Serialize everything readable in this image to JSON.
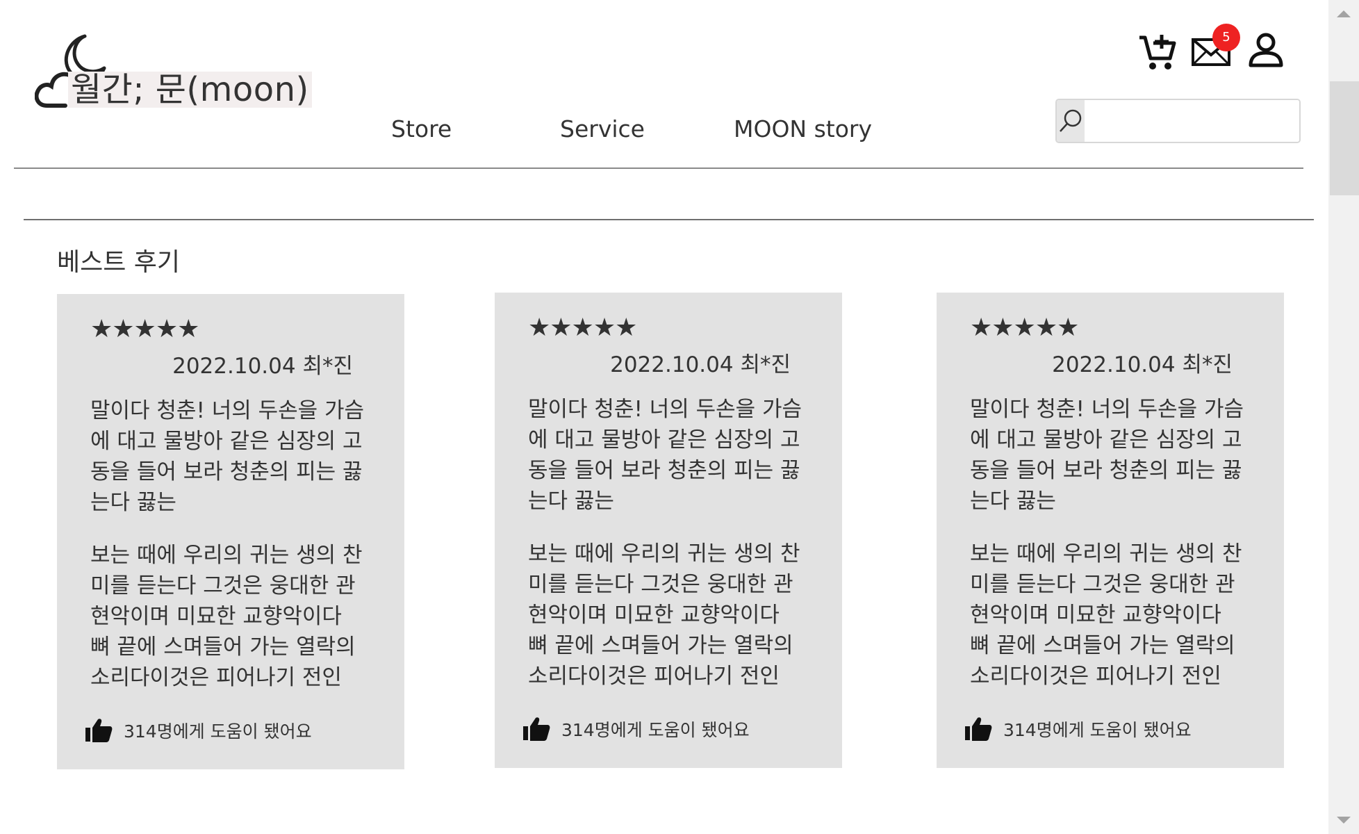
{
  "header": {
    "logo_text": "월간; 문(moon)",
    "nav": [
      "Store",
      "Service",
      "MOON story"
    ],
    "mail_badge_count": "5",
    "search": {
      "placeholder": "",
      "value": ""
    }
  },
  "section": {
    "title": "베스트 후기"
  },
  "reviews": [
    {
      "stars": "★★★★★",
      "meta": "2022.10.04 최*진",
      "p1": "말이다 청춘! 너의 두손을 가슴에 대고 물방아 같은 심장의 고동을 들어 보라 청춘의 피는 끓는다 끓는",
      "p2": "보는 때에 우리의 귀는 생의 찬미를 듣는다 그것은 웅대한 관현악이며 미묘한 교향악이다 뼈 끝에 스며들어 가는 열락의 소리다이것은 피어나기 전인",
      "helpful": "314명에게 도움이 됐어요"
    },
    {
      "stars": "★★★★★",
      "meta": "2022.10.04 최*진",
      "p1": "말이다 청춘! 너의 두손을 가슴에 대고 물방아 같은 심장의 고동을 들어 보라 청춘의 피는 끓는다 끓는",
      "p2": "보는 때에 우리의 귀는 생의 찬미를 듣는다 그것은 웅대한 관현악이며 미묘한 교향악이다 뼈 끝에 스며들어 가는 열락의 소리다이것은 피어나기 전인",
      "helpful": "314명에게 도움이 됐어요"
    },
    {
      "stars": "★★★★★",
      "meta": "2022.10.04 최*진",
      "p1": "말이다 청춘! 너의 두손을 가슴에 대고 물방아 같은 심장의 고동을 들어 보라 청춘의 피는 끓는다 끓는",
      "p2": "보는 때에 우리의 귀는 생의 찬미를 듣는다 그것은 웅대한 관현악이며 미묘한 교향악이다 뼈 끝에 스며들어 가는 열락의 소리다이것은 피어나기 전인",
      "helpful": "314명에게 도움이 됐어요"
    }
  ],
  "icons": {
    "logo": "moon-cloud-icon",
    "cart": "cart-add-icon",
    "mail": "mail-icon",
    "user": "user-icon",
    "search": "search-icon",
    "helpful": "thumbs-up-icon",
    "scroll_up": "arrow-up-icon",
    "scroll_down": "arrow-down-icon"
  },
  "colors": {
    "badge": "#ee2222",
    "card_bg": "#e2e2e2",
    "text": "#333333"
  }
}
